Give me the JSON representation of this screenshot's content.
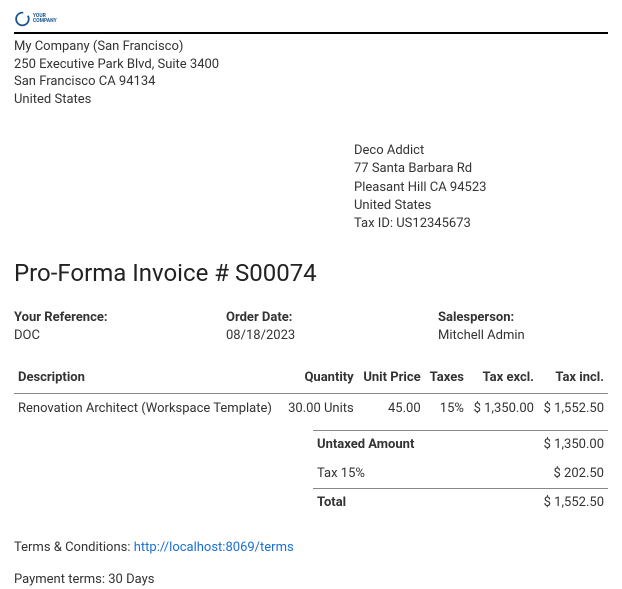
{
  "company": {
    "logo_text": "YOUR COMPANY",
    "name": "My Company (San Francisco)",
    "street": "250 Executive Park Blvd, Suite 3400",
    "city_line": "San Francisco CA 94134",
    "country": "United States"
  },
  "customer": {
    "name": "Deco Addict",
    "street": "77 Santa Barbara Rd",
    "city_line": "Pleasant Hill CA 94523",
    "country": "United States",
    "tax_id_label": "Tax ID:",
    "tax_id": "US12345673"
  },
  "title": "Pro-Forma Invoice # S00074",
  "meta": {
    "reference_label": "Your Reference:",
    "reference": "DOC",
    "order_date_label": "Order Date:",
    "order_date": "08/18/2023",
    "salesperson_label": "Salesperson:",
    "salesperson": "Mitchell Admin"
  },
  "columns": {
    "description": "Description",
    "quantity": "Quantity",
    "unit_price": "Unit Price",
    "taxes": "Taxes",
    "tax_excl": "Tax excl.",
    "tax_incl": "Tax incl."
  },
  "lines": [
    {
      "description": "Renovation Architect (Workspace Template)",
      "quantity": "30.00 Units",
      "unit_price": "45.00",
      "taxes": "15%",
      "tax_excl": "$ 1,350.00",
      "tax_incl": "$ 1,552.50"
    }
  ],
  "totals": {
    "untaxed_label": "Untaxed Amount",
    "untaxed": "$ 1,350.00",
    "tax_label": "Tax 15%",
    "tax": "$ 202.50",
    "total_label": "Total",
    "total": "$ 1,552.50"
  },
  "terms": {
    "label": "Terms & Conditions:",
    "link_text": "http://localhost:8069/terms",
    "link_href": "http://localhost:8069/terms"
  },
  "payment_terms": "Payment terms: 30 Days"
}
